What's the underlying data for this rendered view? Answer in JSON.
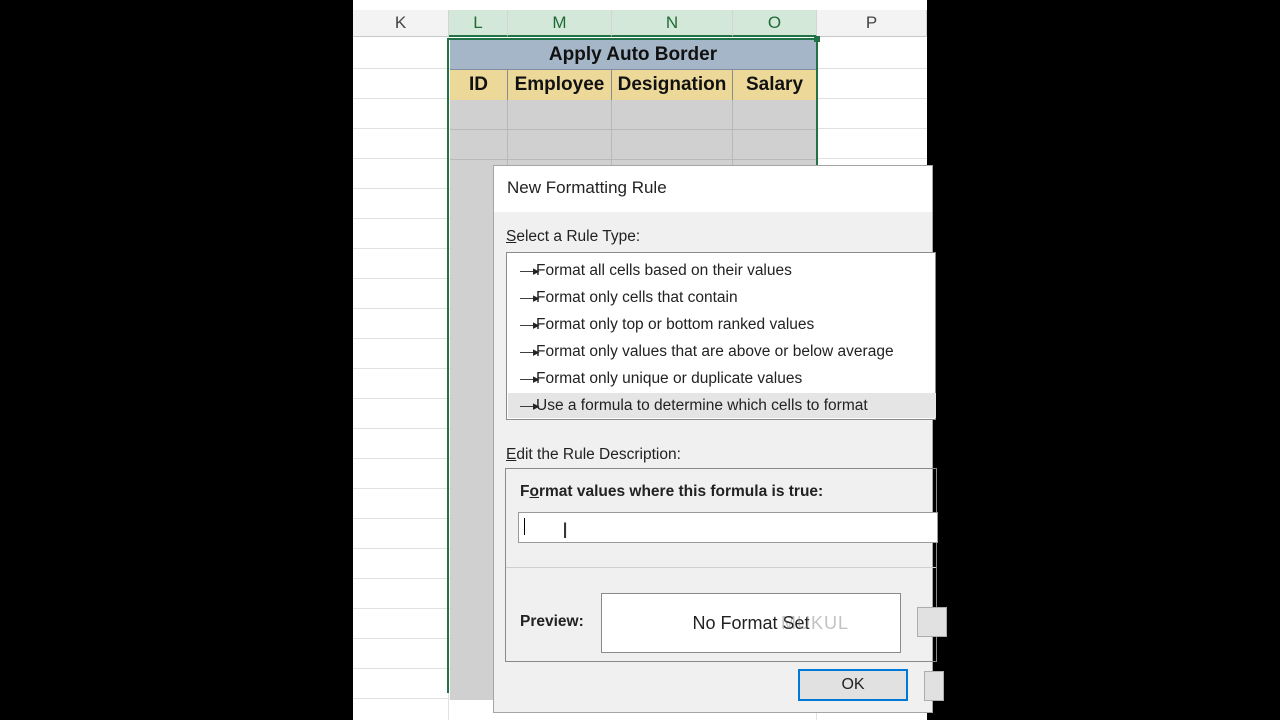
{
  "spreadsheet": {
    "columns": [
      {
        "label": "K",
        "selected": false
      },
      {
        "label": "L",
        "selected": true
      },
      {
        "label": "M",
        "selected": true
      },
      {
        "label": "N",
        "selected": true
      },
      {
        "label": "O",
        "selected": true
      },
      {
        "label": "P",
        "selected": false
      }
    ],
    "table": {
      "title": "Apply Auto Border",
      "headers": [
        "ID",
        "Employee",
        "Designation",
        "Salary"
      ]
    },
    "colors": {
      "title_fill": "#a4b6c8",
      "header_fill": "#ecd99a",
      "body_fill": "#d0d0d0",
      "selection_border": "#217346"
    }
  },
  "dialog": {
    "title": "New Formatting Rule",
    "rule_type_label_accel": "S",
    "rule_type_label_rest": "elect a Rule Type:",
    "rule_types": [
      {
        "label": "Format all cells based on their values",
        "selected": false
      },
      {
        "label": "Format only cells that contain",
        "selected": false
      },
      {
        "label": "Format only top or bottom ranked values",
        "selected": false
      },
      {
        "label": "Format only values that are above or below average",
        "selected": false
      },
      {
        "label": "Format only unique or duplicate values",
        "selected": false
      },
      {
        "label": "Use a formula to determine which cells to format",
        "selected": true
      }
    ],
    "rule_arrow_icon": "arrow-bullet-icon",
    "description_label_accel": "E",
    "description_label_rest": "dit the Rule Description:",
    "formula_label_pre": "F",
    "formula_label_accel": "o",
    "formula_label_rest": "rmat values where this formula is true:",
    "formula_value": "",
    "preview_label": "Preview:",
    "preview_text": "No Format Set",
    "watermark": "MUKUL",
    "ok_label": "OK"
  }
}
